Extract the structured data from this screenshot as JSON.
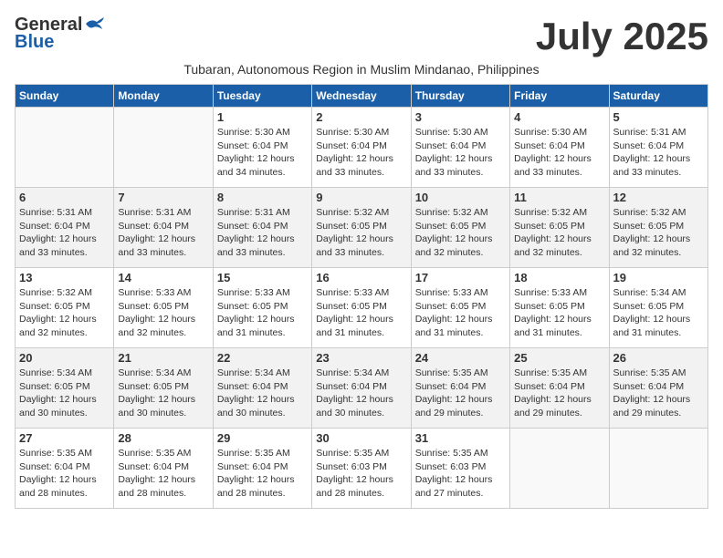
{
  "header": {
    "logo_line1": "General",
    "logo_line2": "Blue",
    "month_title": "July 2025",
    "subtitle": "Tubaran, Autonomous Region in Muslim Mindanao, Philippines"
  },
  "weekdays": [
    "Sunday",
    "Monday",
    "Tuesday",
    "Wednesday",
    "Thursday",
    "Friday",
    "Saturday"
  ],
  "weeks": [
    {
      "alt": false,
      "days": [
        {
          "num": "",
          "info": ""
        },
        {
          "num": "",
          "info": ""
        },
        {
          "num": "1",
          "info": "Sunrise: 5:30 AM\nSunset: 6:04 PM\nDaylight: 12 hours\nand 34 minutes."
        },
        {
          "num": "2",
          "info": "Sunrise: 5:30 AM\nSunset: 6:04 PM\nDaylight: 12 hours\nand 33 minutes."
        },
        {
          "num": "3",
          "info": "Sunrise: 5:30 AM\nSunset: 6:04 PM\nDaylight: 12 hours\nand 33 minutes."
        },
        {
          "num": "4",
          "info": "Sunrise: 5:30 AM\nSunset: 6:04 PM\nDaylight: 12 hours\nand 33 minutes."
        },
        {
          "num": "5",
          "info": "Sunrise: 5:31 AM\nSunset: 6:04 PM\nDaylight: 12 hours\nand 33 minutes."
        }
      ]
    },
    {
      "alt": true,
      "days": [
        {
          "num": "6",
          "info": "Sunrise: 5:31 AM\nSunset: 6:04 PM\nDaylight: 12 hours\nand 33 minutes."
        },
        {
          "num": "7",
          "info": "Sunrise: 5:31 AM\nSunset: 6:04 PM\nDaylight: 12 hours\nand 33 minutes."
        },
        {
          "num": "8",
          "info": "Sunrise: 5:31 AM\nSunset: 6:04 PM\nDaylight: 12 hours\nand 33 minutes."
        },
        {
          "num": "9",
          "info": "Sunrise: 5:32 AM\nSunset: 6:05 PM\nDaylight: 12 hours\nand 33 minutes."
        },
        {
          "num": "10",
          "info": "Sunrise: 5:32 AM\nSunset: 6:05 PM\nDaylight: 12 hours\nand 32 minutes."
        },
        {
          "num": "11",
          "info": "Sunrise: 5:32 AM\nSunset: 6:05 PM\nDaylight: 12 hours\nand 32 minutes."
        },
        {
          "num": "12",
          "info": "Sunrise: 5:32 AM\nSunset: 6:05 PM\nDaylight: 12 hours\nand 32 minutes."
        }
      ]
    },
    {
      "alt": false,
      "days": [
        {
          "num": "13",
          "info": "Sunrise: 5:32 AM\nSunset: 6:05 PM\nDaylight: 12 hours\nand 32 minutes."
        },
        {
          "num": "14",
          "info": "Sunrise: 5:33 AM\nSunset: 6:05 PM\nDaylight: 12 hours\nand 32 minutes."
        },
        {
          "num": "15",
          "info": "Sunrise: 5:33 AM\nSunset: 6:05 PM\nDaylight: 12 hours\nand 31 minutes."
        },
        {
          "num": "16",
          "info": "Sunrise: 5:33 AM\nSunset: 6:05 PM\nDaylight: 12 hours\nand 31 minutes."
        },
        {
          "num": "17",
          "info": "Sunrise: 5:33 AM\nSunset: 6:05 PM\nDaylight: 12 hours\nand 31 minutes."
        },
        {
          "num": "18",
          "info": "Sunrise: 5:33 AM\nSunset: 6:05 PM\nDaylight: 12 hours\nand 31 minutes."
        },
        {
          "num": "19",
          "info": "Sunrise: 5:34 AM\nSunset: 6:05 PM\nDaylight: 12 hours\nand 31 minutes."
        }
      ]
    },
    {
      "alt": true,
      "days": [
        {
          "num": "20",
          "info": "Sunrise: 5:34 AM\nSunset: 6:05 PM\nDaylight: 12 hours\nand 30 minutes."
        },
        {
          "num": "21",
          "info": "Sunrise: 5:34 AM\nSunset: 6:05 PM\nDaylight: 12 hours\nand 30 minutes."
        },
        {
          "num": "22",
          "info": "Sunrise: 5:34 AM\nSunset: 6:04 PM\nDaylight: 12 hours\nand 30 minutes."
        },
        {
          "num": "23",
          "info": "Sunrise: 5:34 AM\nSunset: 6:04 PM\nDaylight: 12 hours\nand 30 minutes."
        },
        {
          "num": "24",
          "info": "Sunrise: 5:35 AM\nSunset: 6:04 PM\nDaylight: 12 hours\nand 29 minutes."
        },
        {
          "num": "25",
          "info": "Sunrise: 5:35 AM\nSunset: 6:04 PM\nDaylight: 12 hours\nand 29 minutes."
        },
        {
          "num": "26",
          "info": "Sunrise: 5:35 AM\nSunset: 6:04 PM\nDaylight: 12 hours\nand 29 minutes."
        }
      ]
    },
    {
      "alt": false,
      "days": [
        {
          "num": "27",
          "info": "Sunrise: 5:35 AM\nSunset: 6:04 PM\nDaylight: 12 hours\nand 28 minutes."
        },
        {
          "num": "28",
          "info": "Sunrise: 5:35 AM\nSunset: 6:04 PM\nDaylight: 12 hours\nand 28 minutes."
        },
        {
          "num": "29",
          "info": "Sunrise: 5:35 AM\nSunset: 6:04 PM\nDaylight: 12 hours\nand 28 minutes."
        },
        {
          "num": "30",
          "info": "Sunrise: 5:35 AM\nSunset: 6:03 PM\nDaylight: 12 hours\nand 28 minutes."
        },
        {
          "num": "31",
          "info": "Sunrise: 5:35 AM\nSunset: 6:03 PM\nDaylight: 12 hours\nand 27 minutes."
        },
        {
          "num": "",
          "info": ""
        },
        {
          "num": "",
          "info": ""
        }
      ]
    }
  ]
}
